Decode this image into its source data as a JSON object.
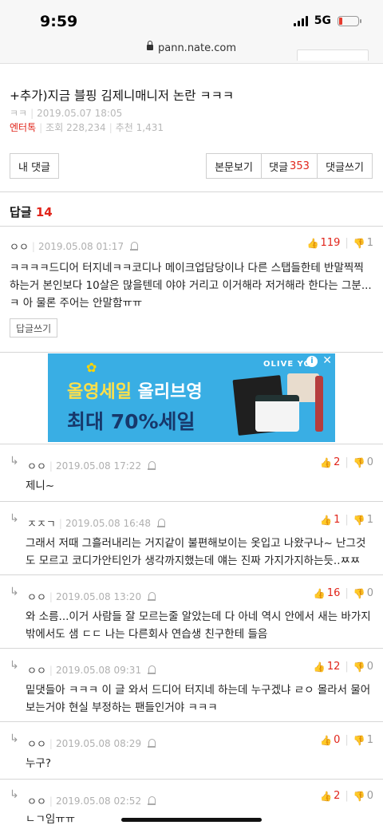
{
  "status": {
    "time": "9:59",
    "network": "5G"
  },
  "browser": {
    "url": "pann.nate.com"
  },
  "article": {
    "title": "+추가)지금 블핑 김제니매니저 논란 ㅋㅋㅋ",
    "author": "ㅋㅋ",
    "date": "2019.05.07 18:05",
    "category": "엔터톡",
    "views": "조회 228,234",
    "recommends": "추천 1,431"
  },
  "buttons": {
    "my_comments": "내 댓글",
    "view_body": "본문보기",
    "comments_label": "댓글",
    "comments_count": "353",
    "write_comment": "댓글쓰기"
  },
  "replies": {
    "label": "답글",
    "count": "14"
  },
  "top_comment": {
    "author": "ㅇㅇ",
    "date": "2019.05.08 01:17",
    "up": "119",
    "down": "1",
    "text": "ㅋㅋㅋㅋ드디어 터지네ㅋㅋ코디나 메이크업담당이나 다른 스탭들한테 반말찍찍하는거 본인보다 10살은 많을텐데 야야 거리고 이거해라 저거해라 한다는 그분...ㅋ 아 물론 주어는 안말함ㅠㅠ",
    "reply_button": "답글쓰기"
  },
  "ad": {
    "line1_a": "올영세일",
    "line1_b": " 올리브영",
    "line2": "최대 70%세일",
    "brand": "OLIVE YO",
    "info": "i",
    "close": "✕"
  },
  "comments": [
    {
      "author": "ㅇㅇ",
      "date": "2019.05.08 17:22",
      "up": "2",
      "down": "0",
      "text": "제니~"
    },
    {
      "author": "ㅈㅈㄱ",
      "date": "2019.05.08 16:48",
      "up": "1",
      "down": "1",
      "text": "그래서 저때 그흘러내리는 거지같이 불편해보이는 옷입고 나왔구나~ 난그것도 모르고 코디가안티인가 생각까지했는데 얘는 진짜 가지가지하는듯..ㅉㅉ"
    },
    {
      "author": "ㅇㅇ",
      "date": "2019.05.08 13:20",
      "up": "16",
      "down": "0",
      "text": "와 소름...이거 사람들 잘 모르는줄 알았는데 다 아네 역시 안에서 새는 바가지 밖에서도 샘 ㄷㄷ 나는 다른회사 연습생 친구한테 들음"
    },
    {
      "author": "ㅇㅇ",
      "date": "2019.05.08 09:31",
      "up": "12",
      "down": "0",
      "text": "밑댓들아 ㅋㅋㅋ 이 글 와서 드디어 터지네 하는데 누구겠냐 ㄹㅇ 몰라서 물어보는거야 현실 부정하는 팬들인거야 ㅋㅋㅋ"
    },
    {
      "author": "ㅇㅇ",
      "date": "2019.05.08 08:29",
      "up": "0",
      "down": "1",
      "text": "누구?"
    },
    {
      "author": "ㅇㅇ",
      "date": "2019.05.08 02:52",
      "up": "2",
      "down": "0",
      "text": "ㄴㄱ임ㅠㅠ"
    }
  ],
  "icons": {
    "thumb_up": "👍",
    "thumb_down": "👎",
    "reply_arrow": "↳"
  },
  "colors": {
    "accent": "#e1251b",
    "ad_bg": "#39aee4"
  }
}
